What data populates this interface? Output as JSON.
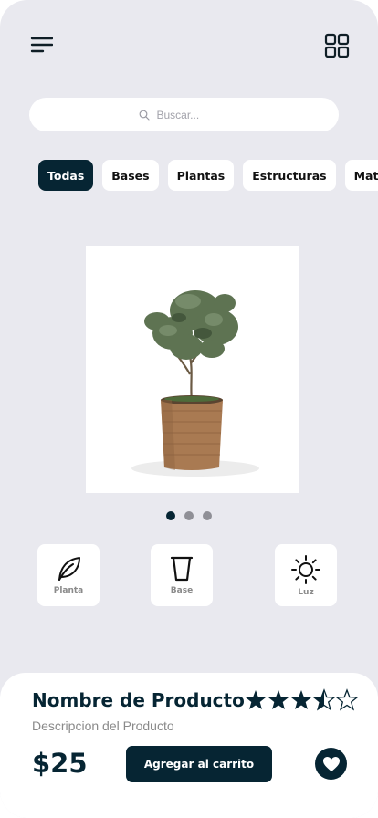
{
  "header": {
    "menu_icon": "menu-icon",
    "grid_icon": "grid-icon"
  },
  "search": {
    "placeholder": "Buscar...",
    "icon": "search-icon"
  },
  "categories": [
    {
      "label": "Todas",
      "active": true
    },
    {
      "label": "Bases",
      "active": false
    },
    {
      "label": "Plantas",
      "active": false
    },
    {
      "label": "Estructuras",
      "active": false
    },
    {
      "label": "Material",
      "active": false
    }
  ],
  "carousel": {
    "image": "potted-olive-tree",
    "total_slides": 3,
    "active_slide": 1
  },
  "features": [
    {
      "label": "Planta",
      "icon": "leaf-icon"
    },
    {
      "label": "Base",
      "icon": "pot-icon"
    },
    {
      "label": "Luz",
      "icon": "sun-icon"
    }
  ],
  "product": {
    "name": "Nombre de Producto",
    "description": "Descripcion del Producto",
    "price": "$25",
    "rating": 3.5,
    "rating_max": 5,
    "add_to_cart_label": "Agregar al carrito",
    "favorite_icon": "heart-icon"
  },
  "colors": {
    "primary": "#062533",
    "background": "#e9e9ef",
    "card": "#ffffff",
    "muted": "#8a8a8a"
  }
}
